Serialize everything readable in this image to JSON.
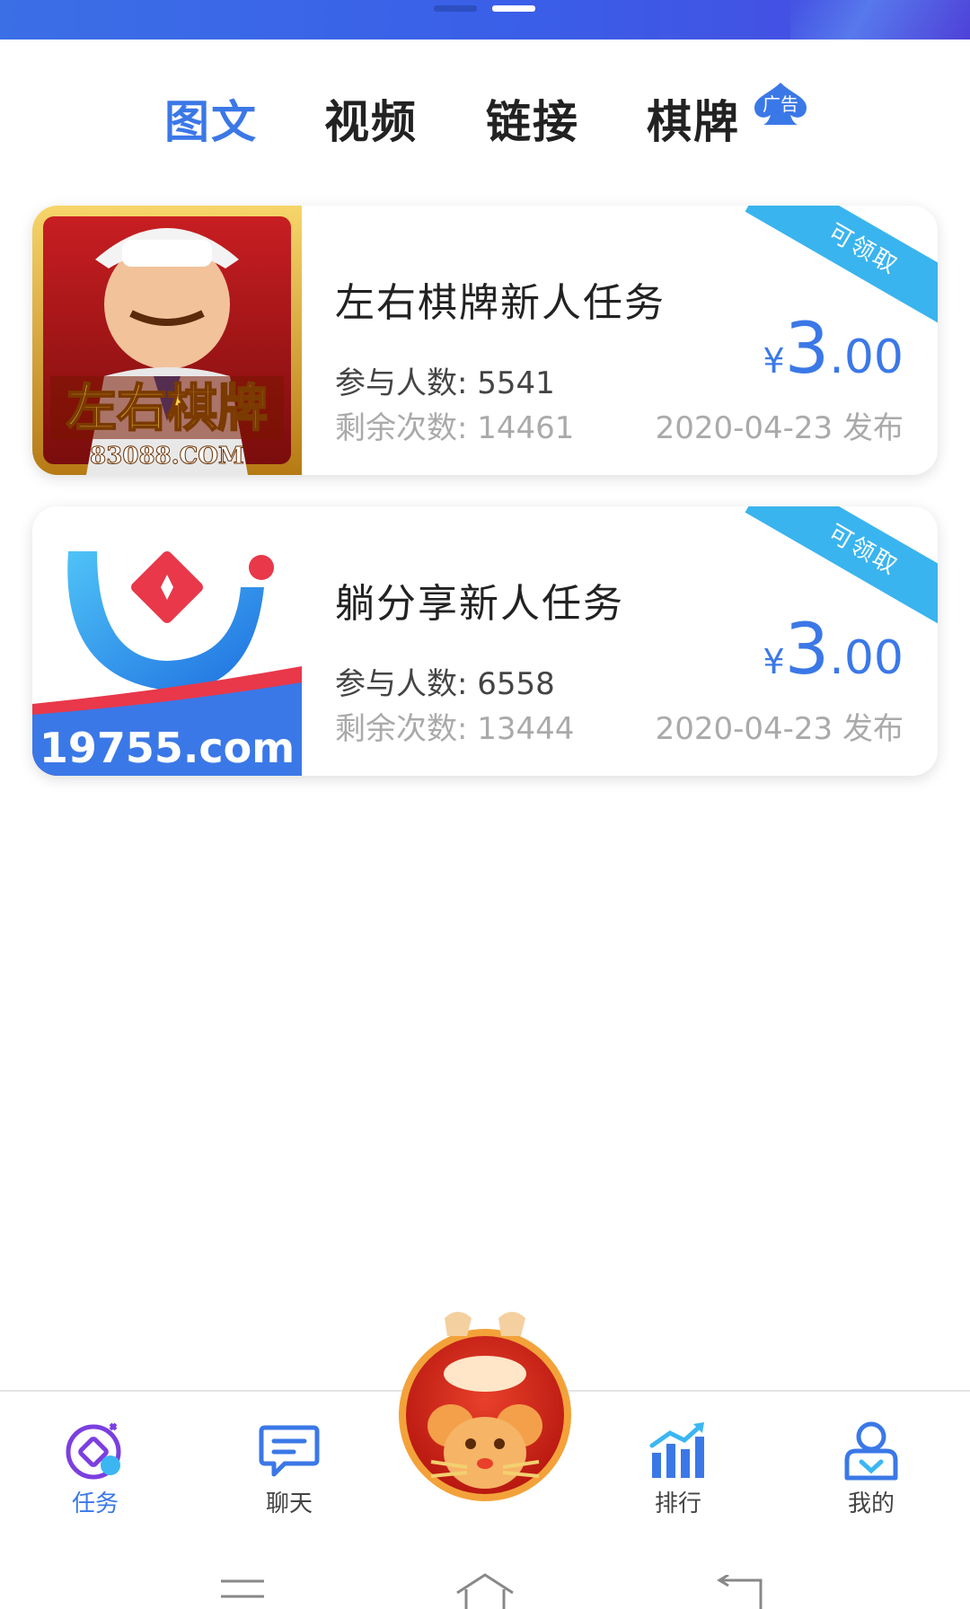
{
  "tabs": [
    {
      "label": "图文",
      "active": true
    },
    {
      "label": "视频",
      "active": false
    },
    {
      "label": "链接",
      "active": false
    },
    {
      "label": "棋牌",
      "active": false
    }
  ],
  "ad_badge": "广告",
  "tasks": [
    {
      "title": "左右棋牌新人任务",
      "participants": "参与人数: 5541",
      "remaining": "剩余次数: 14461",
      "ribbon": "可领取",
      "currency": "¥",
      "price_int": "3",
      "price_dec": ".00",
      "date": "2020-04-23 发布",
      "thumb_text": "左右棋牌",
      "thumb_sub": "83088.COM"
    },
    {
      "title": "躺分享新人任务",
      "participants": "参与人数: 6558",
      "remaining": "剩余次数: 13444",
      "ribbon": "可领取",
      "currency": "¥",
      "price_int": "3",
      "price_dec": ".00",
      "date": "2020-04-23 发布",
      "thumb_text": "19755.com"
    }
  ],
  "nav": [
    {
      "label": "任务",
      "icon": "task-icon",
      "active": true
    },
    {
      "label": "聊天",
      "icon": "chat-icon",
      "active": false
    },
    {
      "label": "排行",
      "icon": "ranking-icon",
      "active": false
    },
    {
      "label": "我的",
      "icon": "profile-icon",
      "active": false
    }
  ],
  "colors": {
    "accent": "#3b78e7",
    "ribbon": "#3ab4ee",
    "banner": "#3a5ee8"
  }
}
